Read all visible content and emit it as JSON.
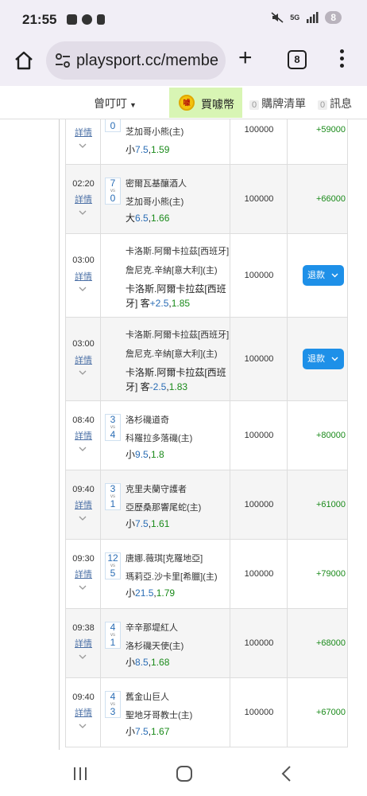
{
  "status_bar": {
    "time": "21:55",
    "network": "5G",
    "notification_count": "8"
  },
  "browser": {
    "url": "playsport.cc/membe",
    "tab_count": "8"
  },
  "site_nav": {
    "user": "曾叮叮",
    "buy_label": "買噱幣",
    "coin_glyph": "噱",
    "cart_count": "0",
    "cart_label": "購牌清單",
    "msg_count": "0",
    "msg_label": "訊息"
  },
  "table": {
    "detail_label": "詳情",
    "vs_label": "vs",
    "refund_label": "退款",
    "rows": [
      {
        "time": "",
        "score_a": "",
        "score_b": "0",
        "team1": "",
        "team2": "芝加哥小熊(主)",
        "pick_prefix": "小",
        "line": "7.5",
        "odds": "1.59",
        "amount": "100000",
        "result": "+59000"
      },
      {
        "time": "02:20",
        "score_a": "7",
        "score_b": "0",
        "team1": "密爾瓦基釀酒人",
        "team2": "芝加哥小熊(主)",
        "pick_prefix": "大",
        "line": "6.5",
        "odds": "1.66",
        "amount": "100000",
        "result": "+66000"
      },
      {
        "time": "03:00",
        "score_a": "",
        "score_b": "",
        "team1": "卡洛斯.阿爾卡拉茲[西班牙]",
        "team2": "詹尼克.辛納[意大利](主)",
        "pick_prefix": "卡洛斯.阿爾卡拉茲[西班牙] 客",
        "line": "+2.5",
        "odds": "1.85",
        "amount": "100000",
        "result": ""
      },
      {
        "time": "03:00",
        "score_a": "",
        "score_b": "",
        "team1": "卡洛斯.阿爾卡拉茲[西班牙]",
        "team2": "詹尼克.辛納[意大利](主)",
        "pick_prefix": "卡洛斯.阿爾卡拉茲[西班牙] 客",
        "line": "-2.5",
        "odds": "1.83",
        "amount": "100000",
        "result": ""
      },
      {
        "time": "08:40",
        "score_a": "3",
        "score_b": "4",
        "team1": "洛杉磯道奇",
        "team2": "科羅拉多落磯(主)",
        "pick_prefix": "小",
        "line": "9.5",
        "odds": "1.8",
        "amount": "100000",
        "result": "+80000"
      },
      {
        "time": "09:40",
        "score_a": "3",
        "score_b": "1",
        "team1": "克里夫蘭守護者",
        "team2": "亞歷桑那響尾蛇(主)",
        "pick_prefix": "小",
        "line": "7.5",
        "odds": "1.61",
        "amount": "100000",
        "result": "+61000"
      },
      {
        "time": "09:30",
        "score_a": "12",
        "score_b": "5",
        "team1": "唐娜.薇琪[克羅地亞]",
        "team2": "瑪莉亞.沙卡里[希臘](主)",
        "pick_prefix": "小",
        "line": "21.5",
        "odds": "1.79",
        "amount": "100000",
        "result": "+79000"
      },
      {
        "time": "09:38",
        "score_a": "4",
        "score_b": "1",
        "team1": "辛辛那堤紅人",
        "team2": "洛杉磯天使(主)",
        "pick_prefix": "小",
        "line": "8.5",
        "odds": "1.68",
        "amount": "100000",
        "result": "+68000"
      },
      {
        "time": "09:40",
        "score_a": "4",
        "score_b": "3",
        "team1": "舊金山巨人",
        "team2": "聖地牙哥教士(主)",
        "pick_prefix": "小",
        "line": "7.5",
        "odds": "1.67",
        "amount": "100000",
        "result": "+67000"
      }
    ]
  },
  "colors": {
    "accent_blue": "#1e90e8",
    "win_green": "#1a8a1a",
    "line_blue": "#2a6db5",
    "buy_bg": "#d8f5b4"
  }
}
